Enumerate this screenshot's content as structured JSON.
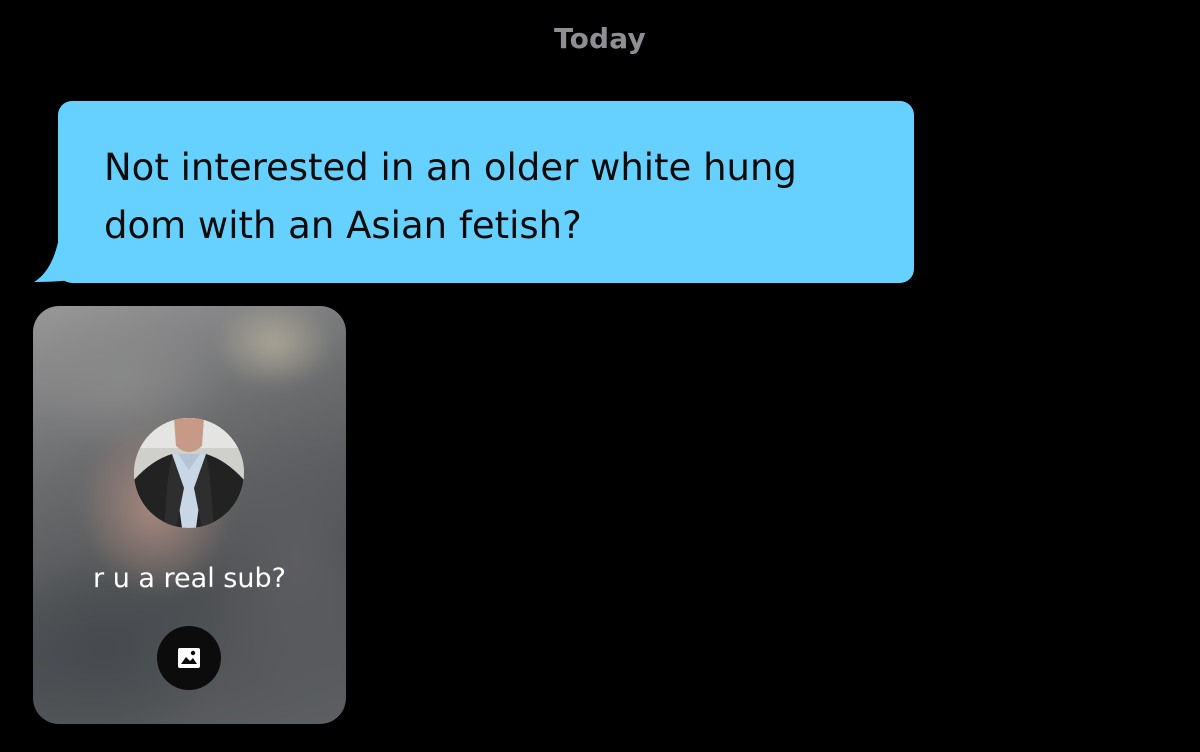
{
  "conversation": {
    "date_separator": "Today"
  },
  "messages": [
    {
      "direction": "outgoing",
      "text": "Not interested in an older white hung dom with an Asian fetish?",
      "bubble_color": "#66d0ff"
    },
    {
      "direction": "incoming",
      "type": "image",
      "caption": "r u a real sub?",
      "media_blurred": true,
      "action_icon": "image-icon"
    }
  ],
  "colors": {
    "background": "#000000",
    "date_text": "#8e8e93",
    "bubble": "#66d0ff",
    "caption_text": "#ffffff"
  }
}
